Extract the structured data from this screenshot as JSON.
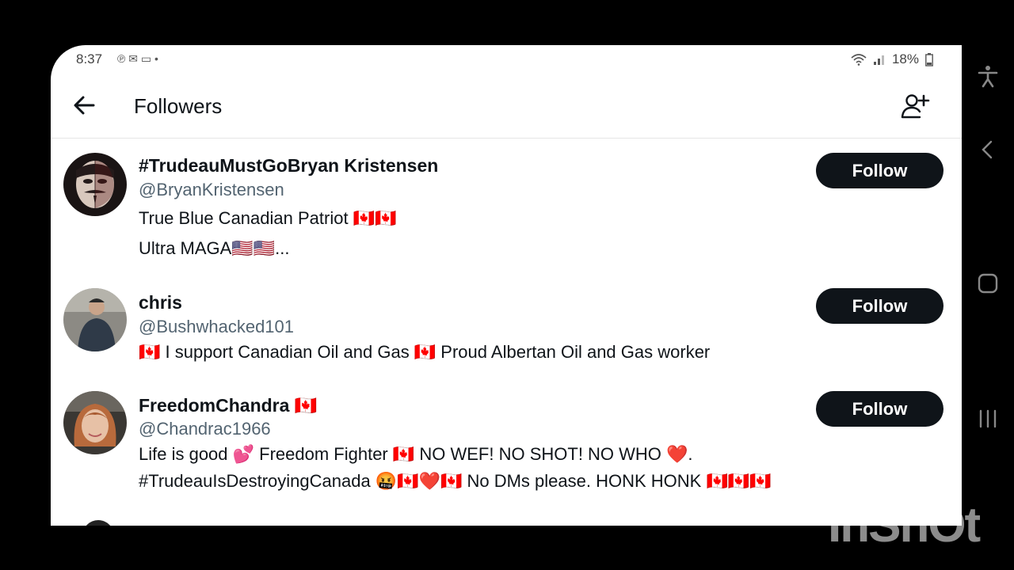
{
  "statusbar": {
    "time": "8:37",
    "battery": "18%",
    "notif_icons": "℗ ✉ ▭ •"
  },
  "header": {
    "title": "Followers"
  },
  "followers": [
    {
      "name": "#TrudeauMustGoBryan Kristensen",
      "handle": "@BryanKristensen",
      "bio1": "True Blue Canadian Patriot 🇨🇦🇨🇦",
      "bio2": "Ultra MAGA🇺🇸🇺🇸...",
      "follow_label": "Follow"
    },
    {
      "name": "chris",
      "handle": "@Bushwhacked101",
      "bio1": "🇨🇦 I support Canadian Oil and Gas 🇨🇦 Proud Albertan Oil and Gas worker",
      "follow_label": "Follow"
    },
    {
      "name": "FreedomChandra 🇨🇦",
      "handle": "@Chandrac1966",
      "bio1": "Life is good 💕 Freedom Fighter 🇨🇦 NO WEF! NO SHOT! NO WHO ❤️.",
      "bio2": "#TrudeauIsDestroyingCanada 🤬🇨🇦❤️🇨🇦 No DMs please.  HONK HONK 🇨🇦🇨🇦🇨🇦",
      "follow_label": "Follow"
    }
  ],
  "watermark": "InShOt",
  "colors": {
    "follow_bg": "#0f1419",
    "handle": "#536471",
    "background": "#000000"
  }
}
